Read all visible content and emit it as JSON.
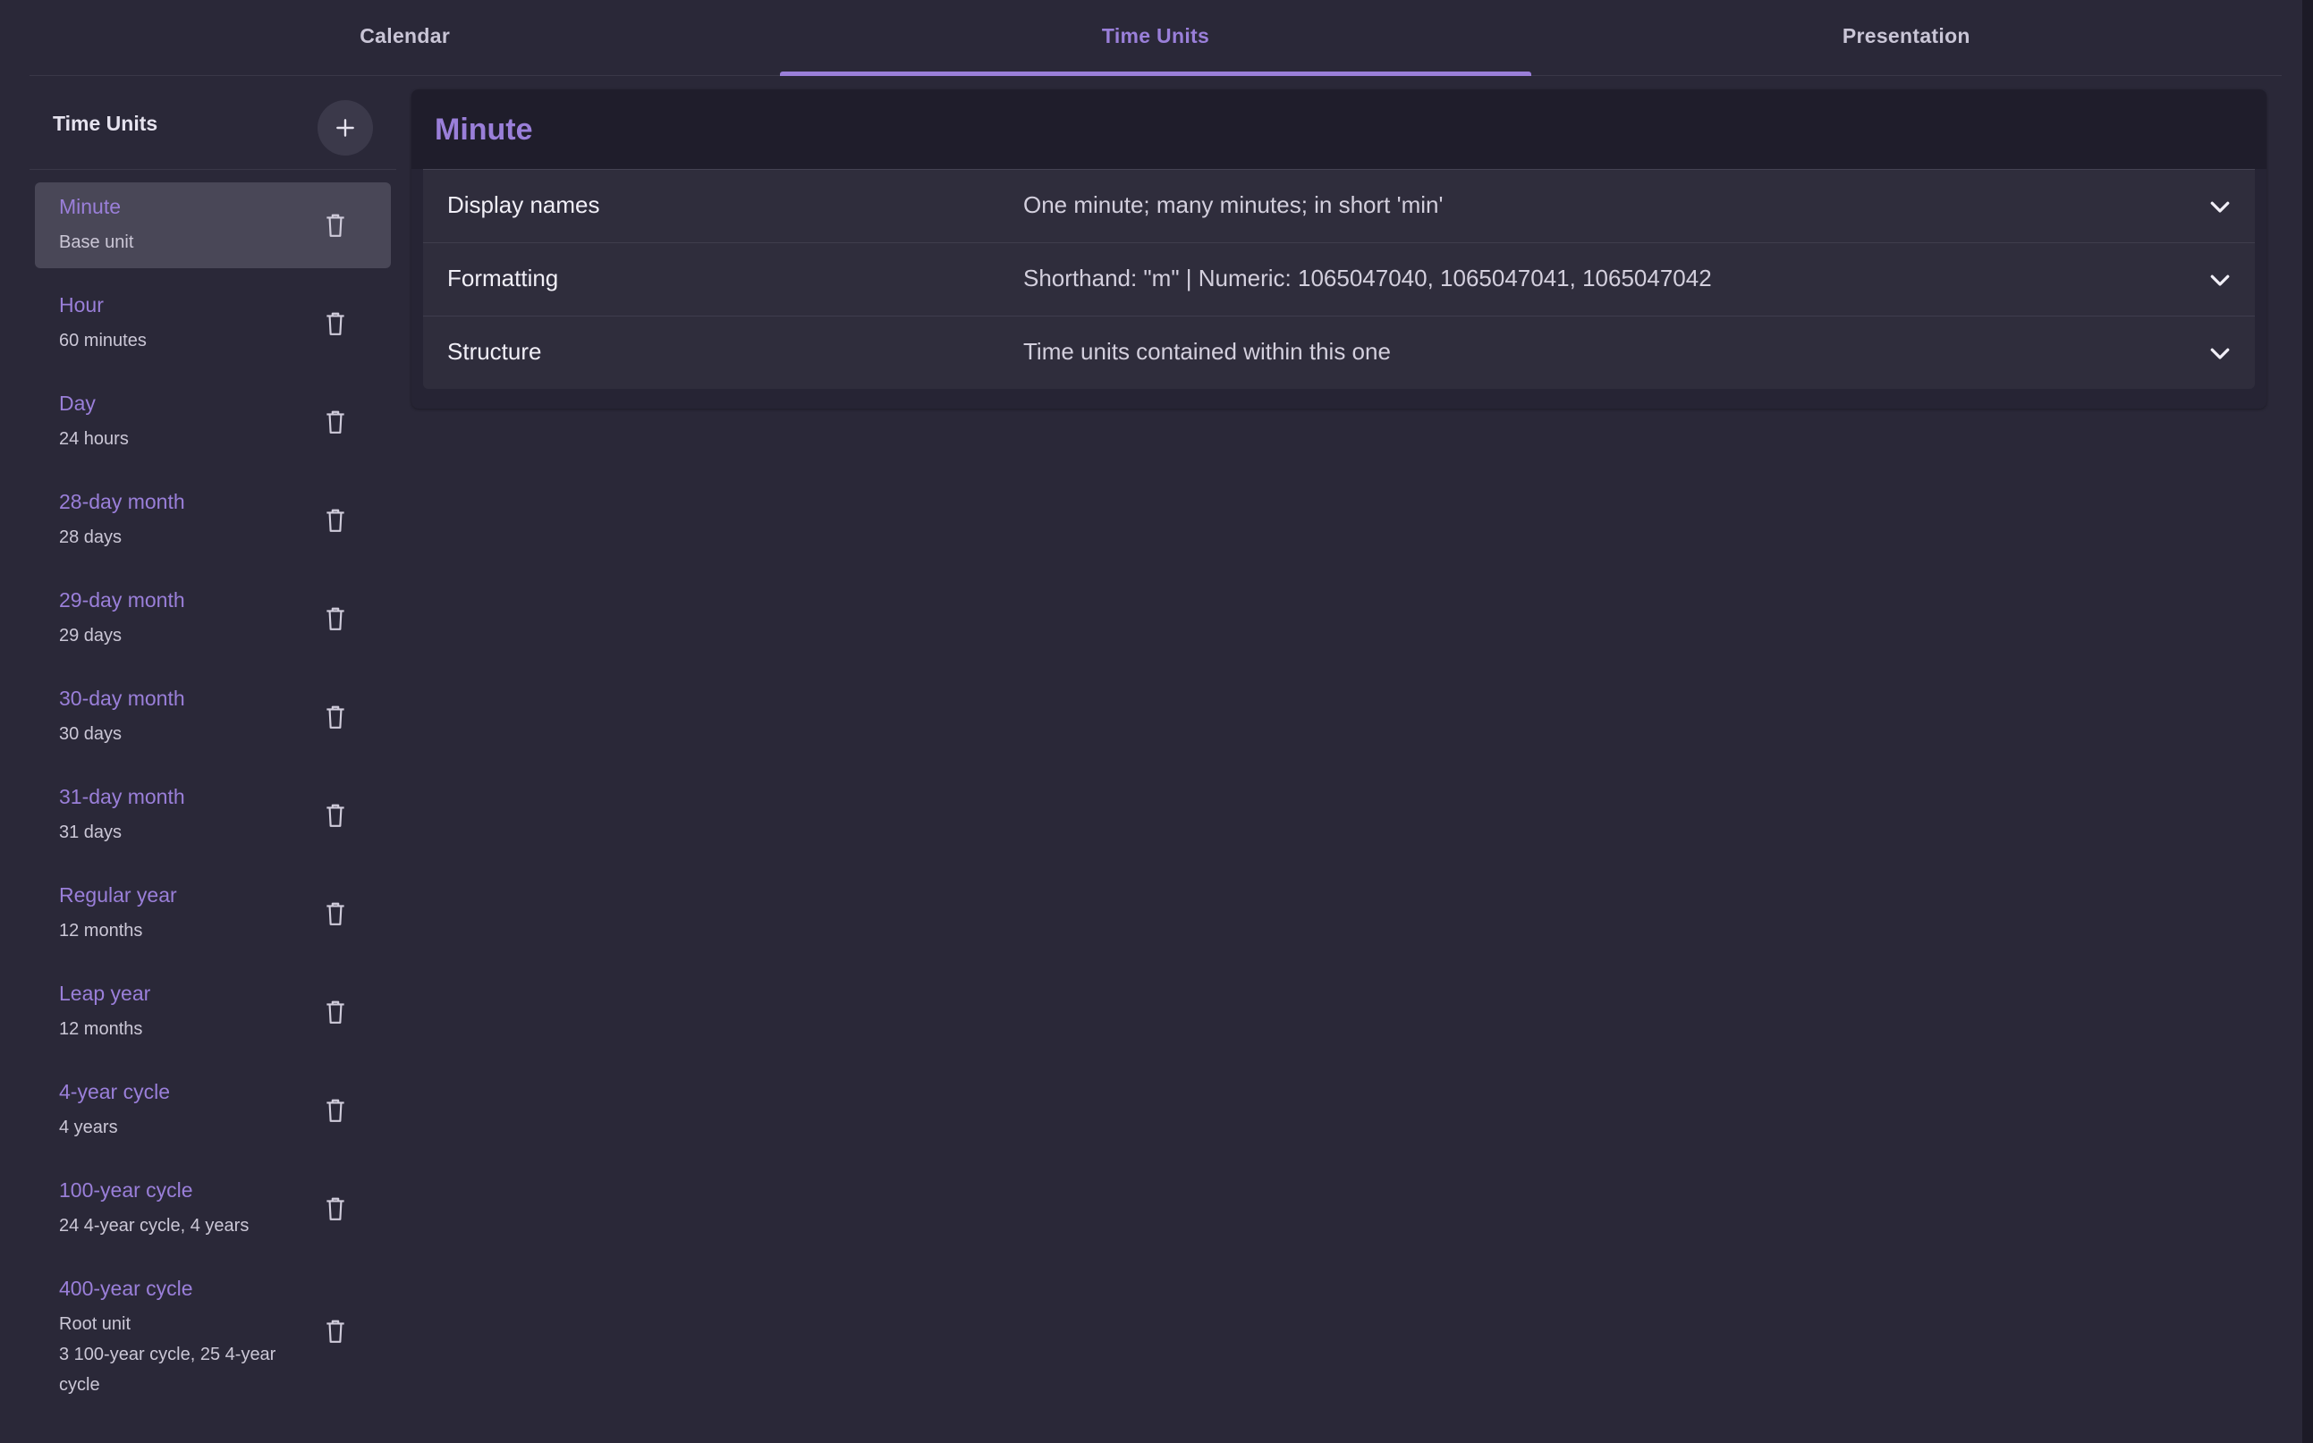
{
  "tabs": [
    {
      "label": "Calendar"
    },
    {
      "label": "Time Units"
    },
    {
      "label": "Presentation"
    }
  ],
  "active_tab": "Time Units",
  "sidebar": {
    "title": "Time Units",
    "add_icon": "plus-icon",
    "delete_icon": "trash-icon",
    "items": [
      {
        "name": "Minute",
        "sub": "Base unit"
      },
      {
        "name": "Hour",
        "sub": "60 minutes"
      },
      {
        "name": "Day",
        "sub": "24 hours"
      },
      {
        "name": "28-day month",
        "sub": "28 days"
      },
      {
        "name": "29-day month",
        "sub": "29 days"
      },
      {
        "name": "30-day month",
        "sub": "30 days"
      },
      {
        "name": "31-day month",
        "sub": "31 days"
      },
      {
        "name": "Regular year",
        "sub": "12 months"
      },
      {
        "name": "Leap year",
        "sub": "12 months"
      },
      {
        "name": "4-year cycle",
        "sub": "4 years"
      },
      {
        "name": "100-year cycle",
        "sub": "24 4-year cycle, 4 years"
      },
      {
        "name": "400-year cycle",
        "sub": "Root unit",
        "sub2": "3 100-year cycle, 25 4-year cycle"
      }
    ]
  },
  "detail": {
    "title": "Minute",
    "expand_icon": "chevron-down-icon",
    "rows": [
      {
        "label": "Display names",
        "value": "One minute; many minutes; in short 'min'"
      },
      {
        "label": "Formatting",
        "value": "Shorthand: \"m\" | Numeric: 1065047040, 1065047041, 1065047042"
      },
      {
        "label": "Structure",
        "value": "Time units contained within this one"
      }
    ]
  },
  "colors": {
    "accent": "#9a7fd9",
    "background": "#2a2838",
    "selected_item": "#494757",
    "panel_header": "#1f1d2b"
  }
}
